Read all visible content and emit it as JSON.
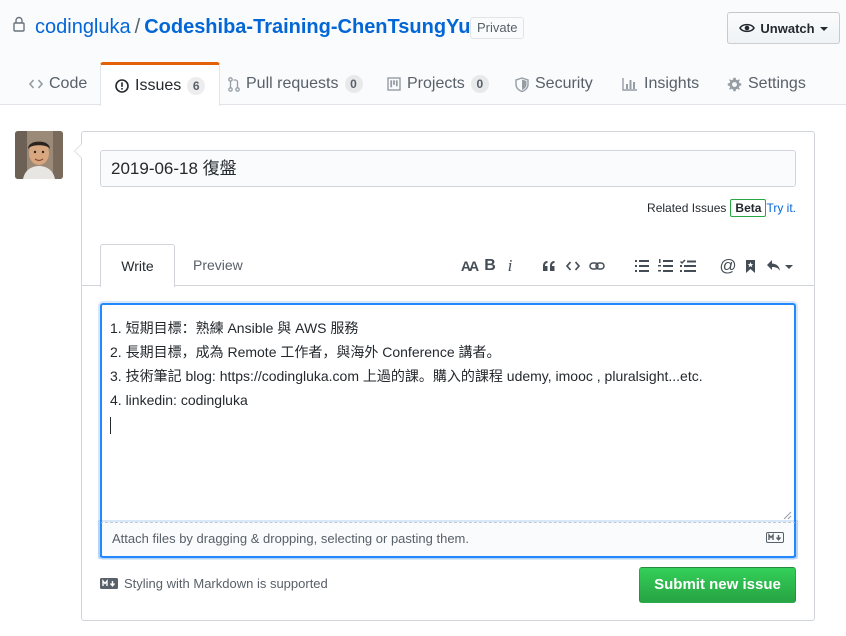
{
  "repo": {
    "owner": "codingluka",
    "separator": "/",
    "name": "Codeshiba-Training-ChenTsungYu",
    "visibility": "Private",
    "watch_label": "Unwatch"
  },
  "nav": {
    "tabs": [
      {
        "label": "Code",
        "icon": "code-icon"
      },
      {
        "label": "Issues",
        "count": "6",
        "icon": "issue-icon",
        "selected": true
      },
      {
        "label": "Pull requests",
        "count": "0",
        "icon": "pull-request-icon"
      },
      {
        "label": "Projects",
        "count": "0",
        "icon": "project-icon"
      },
      {
        "label": "Security",
        "icon": "shield-icon"
      },
      {
        "label": "Insights",
        "icon": "graph-icon"
      },
      {
        "label": "Settings",
        "icon": "gear-icon"
      }
    ]
  },
  "issue_form": {
    "title_value": "2019-06-18 復盤",
    "related_label": "Related Issues",
    "beta_badge": "Beta",
    "try_link": "Try it.",
    "try_suffix": ".",
    "tab_write": "Write",
    "tab_preview": "Preview",
    "body_lines": [
      "1. 短期目標：熟練 Ansible 與 AWS 服務",
      "2. 長期目標，成為 Remote 工作者，與海外 Conference 講者。",
      "3. 技術筆記 blog: https://codingluka.com 上過的課。購入的課程 udemy, imooc , pluralsight...etc.",
      "4. linkedin: codingluka"
    ],
    "attach_text": "Attach files by dragging & dropping, selecting or pasting them.",
    "markdown_note": "Styling with Markdown is supported",
    "submit_label": "Submit new issue"
  },
  "toolbar": {
    "items": [
      "text-size-icon",
      "bold-icon",
      "italic-icon",
      "quote-icon",
      "code-icon",
      "link-icon",
      "unordered-list-icon",
      "ordered-list-icon",
      "task-list-icon",
      "mention-icon",
      "bookmark-icon",
      "reply-icon"
    ],
    "header_label": "AA",
    "bold_label": "B",
    "italic_label": "i",
    "mention_label": "@"
  },
  "colors": {
    "link": "#0366d6",
    "selected_tab_border": "#e36209",
    "focus_border": "#2188ff",
    "submit_green": "#28a745"
  }
}
